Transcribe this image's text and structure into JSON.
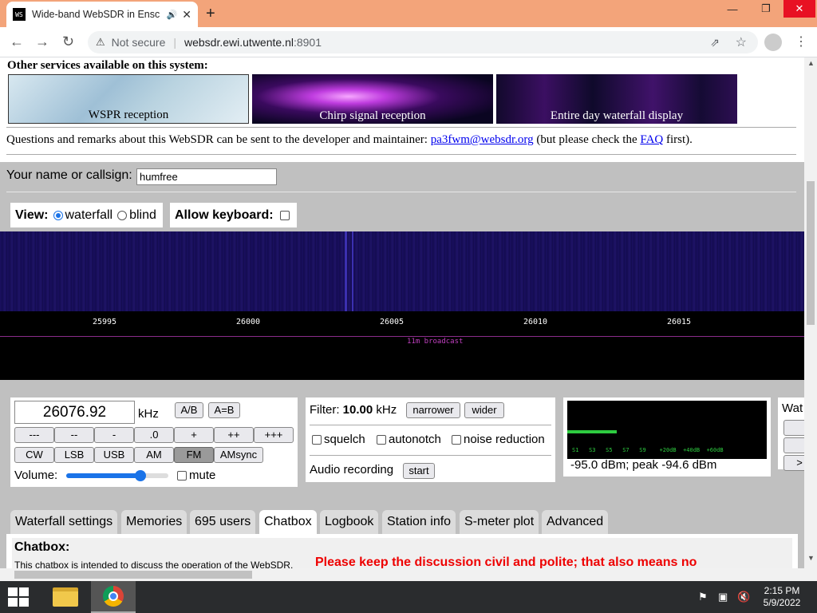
{
  "browser": {
    "tab_title": "Wide-band WebSDR in Ensc",
    "favicon_text": "WS",
    "not_secure": "Not secure",
    "host": "websdr.ewi.utwente.nl",
    "port": ":8901"
  },
  "services": {
    "title": "Other services available on this system:",
    "items": [
      {
        "label": "WSPR reception"
      },
      {
        "label": "Chirp signal reception"
      },
      {
        "label": "Entire day waterfall display"
      }
    ]
  },
  "questions": {
    "before": "Questions and remarks about this WebSDR can be sent to the developer and maintainer: ",
    "email": "pa3fwm@websdr.org",
    "middle": " (but please check the ",
    "faq": "FAQ",
    "after": " first)."
  },
  "callsign": {
    "label": "Your name or callsign:",
    "value": "humfree"
  },
  "view": {
    "label": "View:",
    "waterfall": "waterfall",
    "blind": "blind",
    "selected": "waterfall"
  },
  "keyboard": {
    "label": "Allow keyboard:",
    "checked": false
  },
  "scale": {
    "ticks": [
      "25995",
      "26000",
      "26005",
      "26010",
      "26015"
    ],
    "band_label": "11m broadcast"
  },
  "tuning": {
    "frequency": "26076.92",
    "unit": "kHz",
    "ab": "A/B",
    "aeqb": "A=B",
    "step_buttons": [
      "---",
      "--",
      "-",
      ".0",
      "+",
      "++",
      "+++"
    ],
    "modes": [
      "CW",
      "LSB",
      "USB",
      "AM",
      "FM",
      "AMsync"
    ],
    "active_mode": "FM",
    "volume_label": "Volume:",
    "volume_level": 0.72,
    "mute_label": "mute"
  },
  "filter": {
    "label": "Filter:",
    "value": "10.00",
    "unit": "kHz",
    "narrower": "narrower",
    "wider": "wider",
    "squelch": "squelch",
    "autonotch": "autonotch",
    "noise_reduction": "noise reduction",
    "recording_label": "Audio recording",
    "start": "start"
  },
  "smeter": {
    "scale_labels": "S1   S3   S5   S7   S9    +20dB  +40dB  +60dB",
    "reading": "-95.0 dBm; peak  -94.6 dBm",
    "level": 0.25
  },
  "waterfall_box": {
    "label": "Wat",
    "more": ">"
  },
  "tabs": [
    "Waterfall settings",
    "Memories",
    "695 users",
    "Chatbox",
    "Logbook",
    "Station info",
    "S-meter plot",
    "Advanced"
  ],
  "active_tab": "Chatbox",
  "chatbox": {
    "title": "Chatbox:",
    "desc": "This chatbox is intended to discuss the operation of the WebSDR.",
    "warning": "Please keep the discussion civil and polite; that also means no"
  },
  "taskbar": {
    "time": "2:15 PM",
    "date": "5/9/2022"
  }
}
